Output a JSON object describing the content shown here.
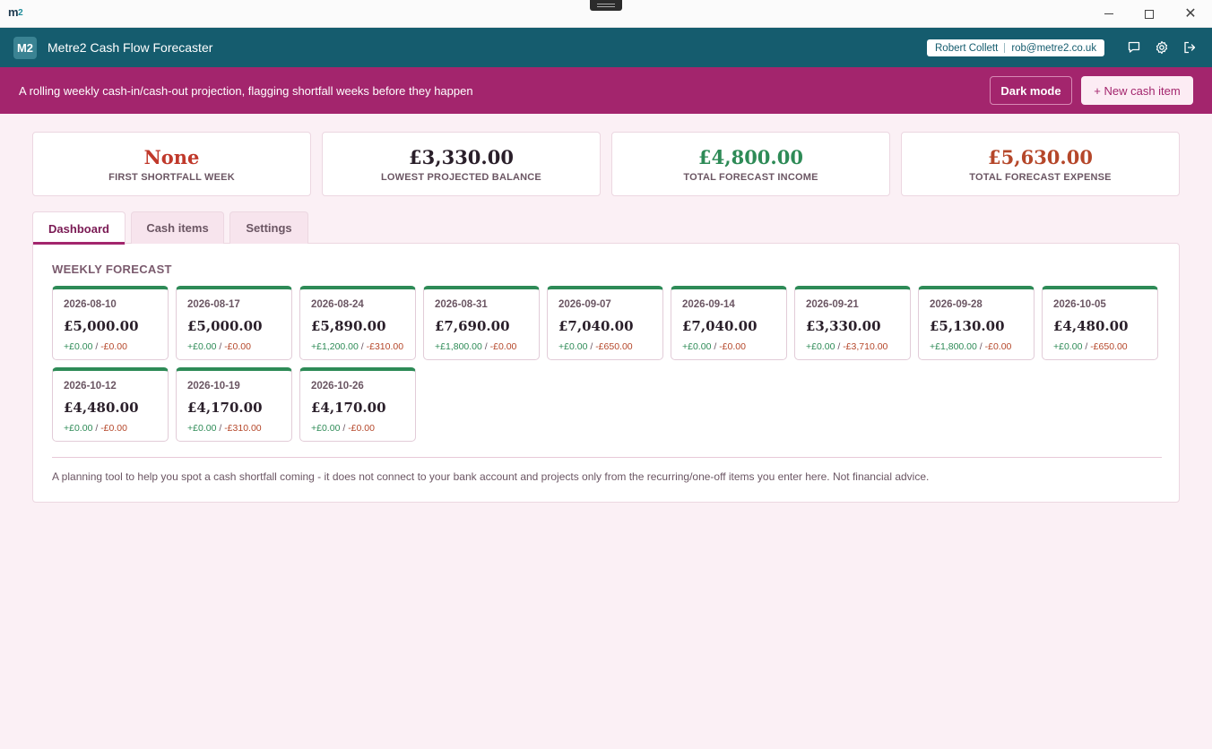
{
  "window": {
    "logo_main": "m",
    "logo_sup": "2",
    "close_glyph": "✕"
  },
  "header": {
    "badge": "M2",
    "title": "Metre2 Cash Flow Forecaster",
    "user_name": "Robert Collett",
    "user_email": "rob@metre2.co.uk"
  },
  "banner": {
    "text": "A rolling weekly cash-in/cash-out projection, flagging shortfall weeks before they happen",
    "dark_mode_label": "Dark mode",
    "new_item_label": "+ New cash item"
  },
  "stats": [
    {
      "value": "None",
      "label": "FIRST SHORTFALL WEEK",
      "color": "#c0392b"
    },
    {
      "value": "£3,330.00",
      "label": "LOWEST PROJECTED BALANCE",
      "color": "#2a1f2a"
    },
    {
      "value": "£4,800.00",
      "label": "TOTAL FORECAST INCOME",
      "color": "#2e8b57"
    },
    {
      "value": "£5,630.00",
      "label": "TOTAL FORECAST EXPENSE",
      "color": "#b5472a"
    }
  ],
  "tabs": [
    {
      "label": "Dashboard",
      "active": true
    },
    {
      "label": "Cash items",
      "active": false
    },
    {
      "label": "Settings",
      "active": false
    }
  ],
  "dashboard": {
    "section_title": "WEEKLY FORECAST",
    "weeks": [
      {
        "date": "2026-08-10",
        "balance": "£5,000.00",
        "in": "+£0.00",
        "out": "-£0.00"
      },
      {
        "date": "2026-08-17",
        "balance": "£5,000.00",
        "in": "+£0.00",
        "out": "-£0.00"
      },
      {
        "date": "2026-08-24",
        "balance": "£5,890.00",
        "in": "+£1,200.00",
        "out": "-£310.00"
      },
      {
        "date": "2026-08-31",
        "balance": "£7,690.00",
        "in": "+£1,800.00",
        "out": "-£0.00"
      },
      {
        "date": "2026-09-07",
        "balance": "£7,040.00",
        "in": "+£0.00",
        "out": "-£650.00"
      },
      {
        "date": "2026-09-14",
        "balance": "£7,040.00",
        "in": "+£0.00",
        "out": "-£0.00"
      },
      {
        "date": "2026-09-21",
        "balance": "£3,330.00",
        "in": "+£0.00",
        "out": "-£3,710.00"
      },
      {
        "date": "2026-09-28",
        "balance": "£5,130.00",
        "in": "+£1,800.00",
        "out": "-£0.00"
      },
      {
        "date": "2026-10-05",
        "balance": "£4,480.00",
        "in": "+£0.00",
        "out": "-£650.00"
      },
      {
        "date": "2026-10-12",
        "balance": "£4,480.00",
        "in": "+£0.00",
        "out": "-£0.00"
      },
      {
        "date": "2026-10-19",
        "balance": "£4,170.00",
        "in": "+£0.00",
        "out": "-£310.00"
      },
      {
        "date": "2026-10-26",
        "balance": "£4,170.00",
        "in": "+£0.00",
        "out": "-£0.00"
      }
    ],
    "footnote": "A planning tool to help you spot a cash shortfall coming - it does not connect to your bank account and projects only from the recurring/one-off items you enter here. Not financial advice."
  }
}
